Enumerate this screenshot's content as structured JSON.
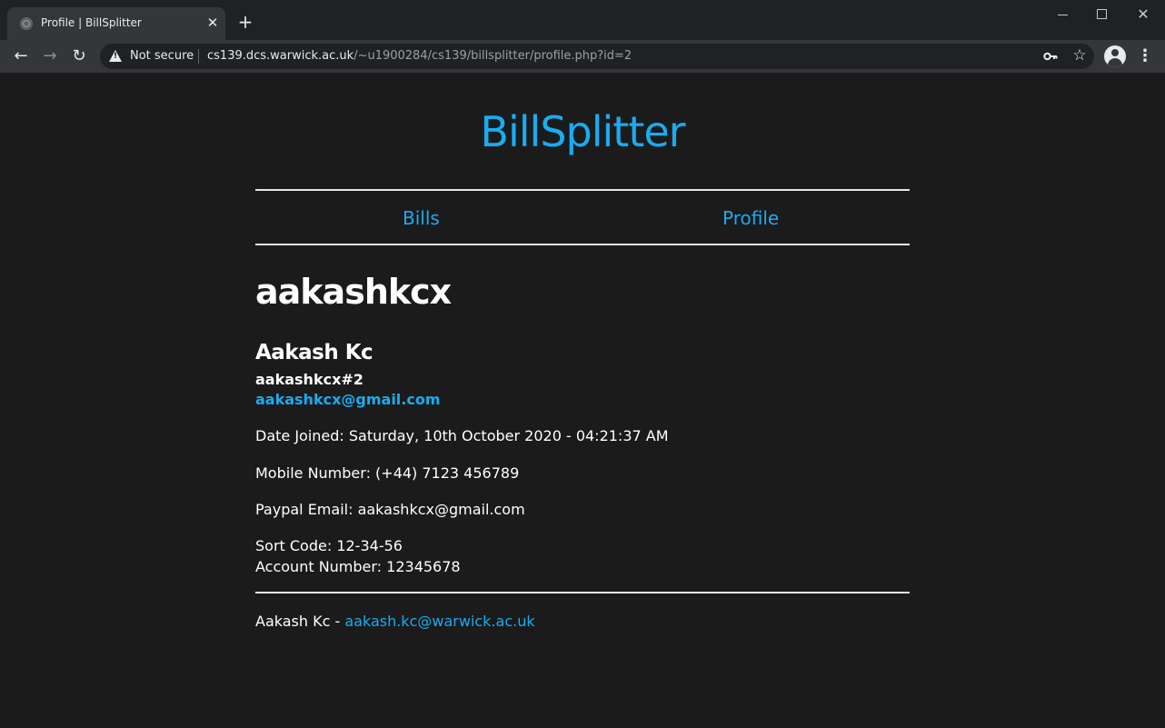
{
  "browser": {
    "tab_title": "Profile | BillSplitter",
    "tab_close": "✕",
    "new_tab": "+",
    "security_label": "Not secure",
    "url_host": "cs139.dcs.warwick.ac.uk",
    "url_path": "/~u1900284/cs139/billsplitter/profile.php?id=2"
  },
  "site": {
    "title": "BillSplitter",
    "nav": [
      {
        "label": "Bills"
      },
      {
        "label": "Profile"
      }
    ]
  },
  "profile": {
    "username": "aakashkcx",
    "full_name": "Aakash Kc",
    "tag": "aakashkcx#2",
    "email": "aakashkcx@gmail.com",
    "date_joined": "Date Joined: Saturday, 10th October 2020 - 04:21:37 AM",
    "mobile": "Mobile Number: (+44) 7123 456789",
    "paypal": "Paypal Email: aakashkcx@gmail.com",
    "sort_code": "Sort Code: 12-34-56",
    "account_number": "Account Number: 12345678"
  },
  "footer": {
    "author": "Aakash Kc - ",
    "email": "aakash.kc@warwick.ac.uk"
  },
  "colors": {
    "accent": "#1aabf0",
    "background": "#1b1b1b"
  }
}
